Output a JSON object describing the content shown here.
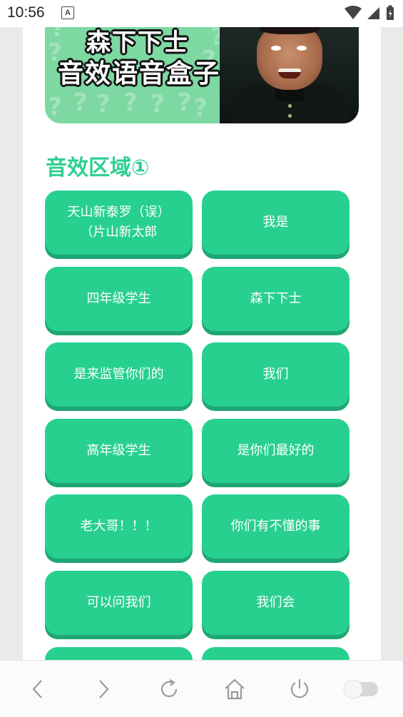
{
  "status_bar": {
    "time": "10:56",
    "notification_icon": "A"
  },
  "banner": {
    "title_line1": "森下下士",
    "title_line2": "音效语音盒子"
  },
  "section": {
    "title": "音效区域①"
  },
  "buttons": [
    {
      "label": "天山新泰罗（误）\n（片山新太郎"
    },
    {
      "label": "我是"
    },
    {
      "label": "四年级学生"
    },
    {
      "label": "森下下士"
    },
    {
      "label": "是来监管你们的"
    },
    {
      "label": "我们"
    },
    {
      "label": "高年级学生"
    },
    {
      "label": "是你们最好的"
    },
    {
      "label": "老大哥！！！"
    },
    {
      "label": "你们有不懂的事"
    },
    {
      "label": "可以问我们"
    },
    {
      "label": "我们会"
    },
    {
      "label": ""
    },
    {
      "label": ""
    }
  ],
  "nav": {
    "icons": [
      "back-icon",
      "forward-icon",
      "refresh-icon",
      "home-icon",
      "power-icon",
      "toggle-icon"
    ]
  },
  "colors": {
    "accent": "#2fcf93",
    "button": "#28d08f",
    "button_shadow": "#1fa672",
    "banner": "#7ed8a2"
  }
}
